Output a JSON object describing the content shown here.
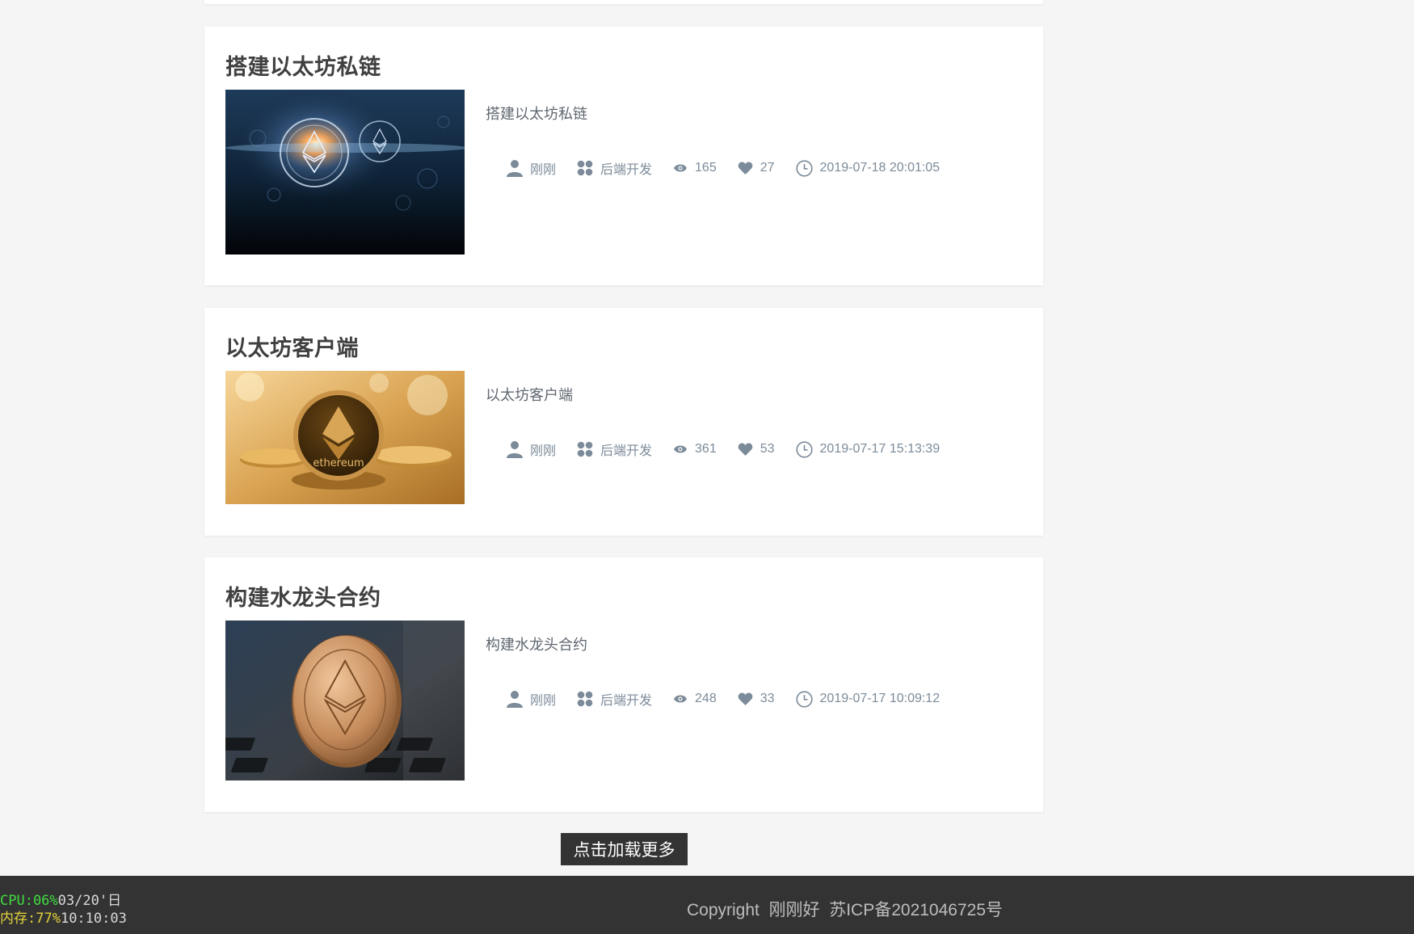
{
  "articles": [
    {
      "title": "搭建以太坊私链",
      "summary": "搭建以太坊私链",
      "author": "刚刚",
      "category": "后端开发",
      "views": "165",
      "likes": "27",
      "date": "2019-07-18 20:01:05",
      "image": "ethereum-network-graphic"
    },
    {
      "title": "以太坊客户端",
      "summary": "以太坊客户端",
      "author": "刚刚",
      "category": "后端开发",
      "views": "361",
      "likes": "53",
      "date": "2019-07-17 15:13:39",
      "image": "ethereum-gold-coin"
    },
    {
      "title": "构建水龙头合约",
      "summary": "构建水龙头合约",
      "author": "刚刚",
      "category": "后端开发",
      "views": "248",
      "likes": "33",
      "date": "2019-07-17 10:09:12",
      "image": "ethereum-coin-on-keyboard"
    }
  ],
  "icons": {
    "author": "user-icon",
    "category": "grid-icon",
    "views": "eye-icon",
    "likes": "heart-icon",
    "date": "clock-icon"
  },
  "load_more_label": "点击加载更多",
  "footer": {
    "copyright": "Copyright  刚刚好  苏ICP备2021046725号"
  },
  "system_monitor": {
    "cpu_label": "CPU:06%",
    "date": "03/20'日",
    "mem_label": "内存:77%",
    "time": "10:10:03"
  },
  "colors": {
    "background": "#f5f5f5",
    "card": "#ffffff",
    "meta_text": "#7c8b99",
    "button": "#333333",
    "footer": "#333333"
  }
}
